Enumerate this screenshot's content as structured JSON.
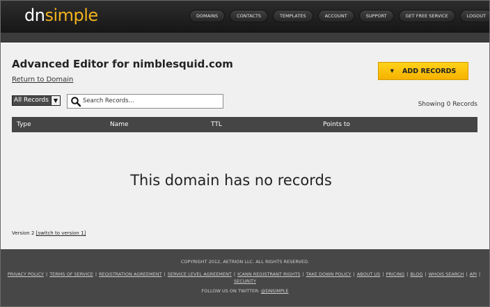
{
  "header": {
    "logo": {
      "part1": "dn",
      "part2": "simple"
    },
    "nav": [
      "DOMAINS",
      "CONTACTS",
      "TEMPLATES",
      "ACCOUNT",
      "SUPPORT",
      "GET FREE SERVICE",
      "LOGOUT"
    ]
  },
  "main": {
    "title": "Advanced Editor for nimblesquid.com",
    "return_link": "Return to Domain",
    "add_button": "ADD RECORDS",
    "filter_value": "All Records",
    "search_placeholder": "Search Records...",
    "showing": "Showing 0 Records",
    "columns": [
      "Type",
      "Name",
      "TTL",
      "Points to"
    ],
    "empty_message": "This domain has no records",
    "version_text": "Version 2",
    "version_link": "[switch to version 1]"
  },
  "footer": {
    "copyright": "COPYRIGHT 2012, AETRION LLC. ALL RIGHTS RESERVED.",
    "links": [
      "PRIVACY POLICY",
      "TERMS OF SERVICE",
      "REGISTRATION AGREEMENT",
      "SERVICE LEVEL AGREEMENT",
      "ICANN REGISTRANT RIGHTS",
      "TAKE DOWN POLICY",
      "ABOUT US",
      "PRICING",
      "BLOG",
      "WHOIS SEARCH",
      "API",
      "SECURITY"
    ],
    "twitter_prefix": "FOLLOW US ON TWITTER:",
    "twitter_handle": "@DNSIMPLE"
  },
  "colors": {
    "accent": "#f2b21d",
    "button": "#ffc90e",
    "header": "#1e1e1e",
    "footer": "#474747"
  },
  "icons": {
    "search": "search-icon",
    "add": "caret-down-icon",
    "select": "chevron-down-icon"
  }
}
